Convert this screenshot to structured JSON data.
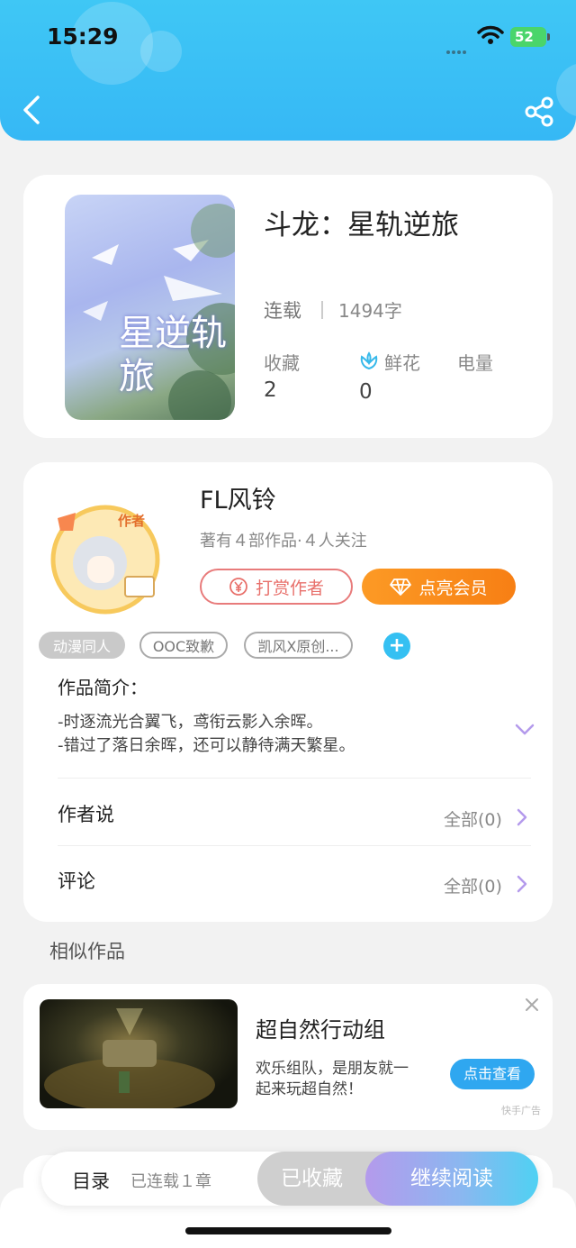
{
  "status_bar": {
    "time": "15:29",
    "battery": "52"
  },
  "book": {
    "title": "斗龙：星轨逆旅",
    "serial_status": "连载",
    "word_count": "1494字",
    "stats": [
      {
        "label": "收藏",
        "value": "2"
      },
      {
        "label": "鲜花",
        "value": "0"
      },
      {
        "label": "电量",
        "value": ""
      }
    ],
    "cover_text": "星逆轨旅"
  },
  "author": {
    "name": "FL风铃",
    "meta": "著有４部作品·４人关注",
    "badge": "作者",
    "tip_button": "打赏作者",
    "vip_button": "点亮会员"
  },
  "tags": [
    "动漫同人",
    "OOC致歉",
    "凯风Ⅹ原创..."
  ],
  "intro": {
    "heading": "作品简介：",
    "lines": [
      "-时逐流光合翼飞，鸢衔云影入余晖。",
      "-错过了落日余晖，还可以静待满天繁星。"
    ]
  },
  "rows": [
    {
      "label": "作者说",
      "value": "全部(0)"
    },
    {
      "label": "评论",
      "value": "全部(0)"
    }
  ],
  "similar": {
    "section_title": "相似作品"
  },
  "ad": {
    "title": "超自然行动组",
    "desc_lines": [
      "欢乐组队，是朋友就一",
      "起来玩超自然！"
    ],
    "button": "点击查看",
    "badge": "快手广告"
  },
  "bottom_bar": {
    "toc": "目录",
    "chapter_count": "已连载１章",
    "collected": "已收藏",
    "continue_read": "继续阅读"
  },
  "colors": {
    "header": "#3fc7f5",
    "accent_purple": "#b49aec",
    "vip_orange": "#fc9a25",
    "tip_red": "#e8706b"
  }
}
